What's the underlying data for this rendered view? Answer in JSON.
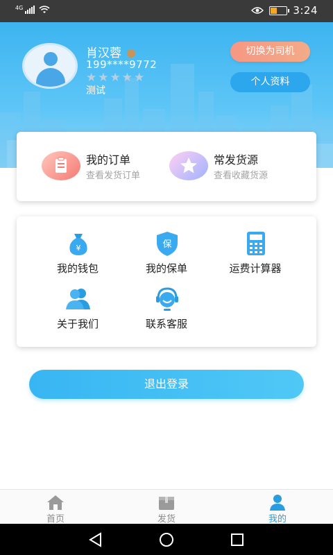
{
  "status_bar": {
    "network": "4G",
    "time": "3:24",
    "battery_level": 0.35
  },
  "profile": {
    "name": "肖汉蓉",
    "phone": "199****9772",
    "stars": "★★★★★",
    "rating": 0,
    "tag": "测试",
    "switch_role_label": "切换为司机",
    "profile_label": "个人资料"
  },
  "quick_links": [
    {
      "title": "我的订单",
      "subtitle": "查看发货订单"
    },
    {
      "title": "常发货源",
      "subtitle": "查看收藏货源"
    }
  ],
  "menu": [
    {
      "label": "我的钱包",
      "icon": "wallet-icon"
    },
    {
      "label": "我的保单",
      "icon": "insurance-shield-icon"
    },
    {
      "label": "运费计算器",
      "icon": "calculator-icon"
    },
    {
      "label": "关于我们",
      "icon": "users-icon"
    },
    {
      "label": "联系客服",
      "icon": "customer-service-icon"
    }
  ],
  "logout_label": "退出登录",
  "tabs": [
    {
      "label": "首页",
      "icon": "home-icon"
    },
    {
      "label": "发货",
      "icon": "shipment-box-icon"
    },
    {
      "label": "我的",
      "icon": "user-icon",
      "active": true
    }
  ],
  "colors": {
    "primary": "#2ca6ec",
    "header": "#3db4f0",
    "switch_button": "#f69784",
    "active_tab": "#2a9de0"
  }
}
